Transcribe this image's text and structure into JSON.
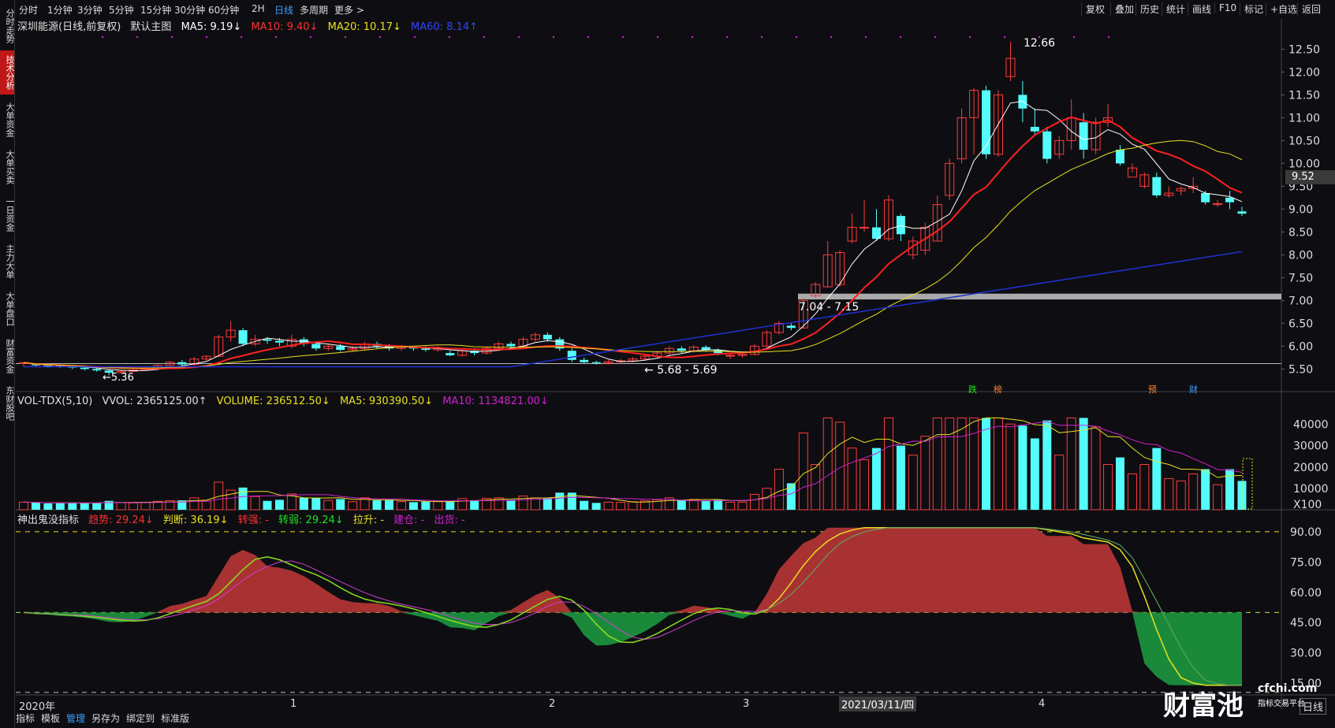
{
  "left_tabs": [
    "分时走势",
    "技术分析",
    "大单资金",
    "大单买卖",
    "一日资金",
    "主力大单",
    "大单盘口",
    "财富资金",
    "东财股吧"
  ],
  "left_tab_active": 1,
  "toolbar_left": [
    "分时",
    "1分钟",
    "3分钟",
    "5分钟",
    "15分钟",
    "30分钟",
    "60分钟",
    "2H",
    "日线",
    "多周期",
    "更多 >"
  ],
  "toolbar_active": "日线",
  "toolbar_right": [
    "复权",
    "叠加",
    "历史",
    "统计",
    "画线",
    "F10",
    "标记",
    "+自选",
    "返回"
  ],
  "main_legend": {
    "stock": "深圳能源(日线,前复权)",
    "chart_name": "默认主图",
    "ma5": "MA5: 9.19↓",
    "ma10": "MA10: 9.40↓",
    "ma20": "MA20: 10.17↓",
    "ma60": "MA60: 8.14↑"
  },
  "vol_legend": {
    "name": "VOL-TDX(5,10)",
    "vvol": "VVOL: 2365125.00↑",
    "volume": "VOLUME: 236512.50↓",
    "ma5": "MA5: 930390.50↓",
    "ma10": "MA10: 1134821.00↓"
  },
  "ind_legend": {
    "name": "神出鬼没指标",
    "trend": "趋势: 29.24↓",
    "judge": "判断: 36.19↓",
    "strong": "转强: -",
    "weak": "转弱: 29.24↓",
    "rise": "拉升: -",
    "build": "建仓: -",
    "ship": "出货: -"
  },
  "price_axis": [
    "12.50",
    "12.00",
    "11.50",
    "11.00",
    "10.50",
    "10.00",
    "9.50",
    "9.00",
    "8.50",
    "8.00",
    "7.50",
    "7.00",
    "6.50",
    "6.00",
    "5.50"
  ],
  "current_price": "9.52",
  "vol_axis": [
    "40000",
    "30000",
    "20000",
    "10000",
    "X100"
  ],
  "ind_axis": [
    "90.00",
    "75.00",
    "60.00",
    "45.00",
    "30.00",
    "15.00"
  ],
  "annotations": {
    "high": "12.66",
    "low1": "5.36",
    "low2": "5.68 - 5.69",
    "band": "7.04 - 7.15"
  },
  "markers": [
    "跌",
    "榜",
    "预",
    "财"
  ],
  "x_axis": [
    "2020年",
    "1",
    "2",
    "3",
    "2021/03/11/四",
    "4"
  ],
  "period_label": "日线",
  "bottom_bar": [
    "指标",
    "模板",
    "管理",
    "另存为",
    "绑定到",
    "标准版"
  ],
  "bottom_active": "管理",
  "watermark": {
    "big": "财富池",
    "site": "cfchi.com",
    "sub": "指标交易平台"
  },
  "colors": {
    "up": "#ff3b3b",
    "down": "#54fcfc",
    "ma5": "#ffffff",
    "ma10": "#ff2020",
    "ma20": "#e8e020",
    "ma60": "#2030d0",
    "area_up": "#a83232",
    "area_down": "#1a8a3a"
  },
  "chart_data": {
    "type": "candlestick",
    "price_range": [
      5.3,
      12.8
    ],
    "candles": [
      [
        5.62,
        5.64,
        5.55,
        5.66
      ],
      [
        5.6,
        5.58,
        5.54,
        5.63
      ],
      [
        5.58,
        5.57,
        5.53,
        5.6
      ],
      [
        5.57,
        5.55,
        5.52,
        5.59
      ],
      [
        5.55,
        5.53,
        5.5,
        5.57
      ],
      [
        5.53,
        5.5,
        5.47,
        5.55
      ],
      [
        5.5,
        5.47,
        5.44,
        5.52
      ],
      [
        5.47,
        5.42,
        5.36,
        5.49
      ],
      [
        5.42,
        5.45,
        5.4,
        5.48
      ],
      [
        5.45,
        5.48,
        5.43,
        5.5
      ],
      [
        5.48,
        5.52,
        5.46,
        5.54
      ],
      [
        5.52,
        5.58,
        5.5,
        5.6
      ],
      [
        5.58,
        5.65,
        5.56,
        5.68
      ],
      [
        5.65,
        5.6,
        5.55,
        5.7
      ],
      [
        5.6,
        5.72,
        5.58,
        5.76
      ],
      [
        5.72,
        5.78,
        5.68,
        5.8
      ],
      [
        5.78,
        6.2,
        5.76,
        6.25
      ],
      [
        6.2,
        6.35,
        6.1,
        6.55
      ],
      [
        6.35,
        6.05,
        6.0,
        6.4
      ],
      [
        6.05,
        6.15,
        6.0,
        6.25
      ],
      [
        6.15,
        6.12,
        6.05,
        6.2
      ],
      [
        6.12,
        6.08,
        6.0,
        6.18
      ],
      [
        6.0,
        6.15,
        5.95,
        6.25
      ],
      [
        6.15,
        6.05,
        6.0,
        6.2
      ],
      [
        6.05,
        5.95,
        5.9,
        6.1
      ],
      [
        5.95,
        6.0,
        5.9,
        6.05
      ],
      [
        6.0,
        5.92,
        5.88,
        6.05
      ],
      [
        5.92,
        5.95,
        5.88,
        6.0
      ],
      [
        5.95,
        6.05,
        5.9,
        6.1
      ],
      [
        6.05,
        6.0,
        5.95,
        6.1
      ],
      [
        6.0,
        5.95,
        5.9,
        6.05
      ],
      [
        5.95,
        5.98,
        5.9,
        6.02
      ],
      [
        5.98,
        5.95,
        5.9,
        6.0
      ],
      [
        5.95,
        5.92,
        5.88,
        6.0
      ],
      [
        5.92,
        5.95,
        5.88,
        6.0
      ],
      [
        5.85,
        5.8,
        5.78,
        5.9
      ],
      [
        5.8,
        5.9,
        5.78,
        5.95
      ],
      [
        5.9,
        5.85,
        5.8,
        5.95
      ],
      [
        5.85,
        5.95,
        5.82,
        6.0
      ],
      [
        5.95,
        6.05,
        5.9,
        6.1
      ],
      [
        6.05,
        6.0,
        5.95,
        6.1
      ],
      [
        6.0,
        6.15,
        5.98,
        6.2
      ],
      [
        6.15,
        6.25,
        6.1,
        6.3
      ],
      [
        6.25,
        6.15,
        6.1,
        6.3
      ],
      [
        6.15,
        5.95,
        5.9,
        6.2
      ],
      [
        5.9,
        5.7,
        5.65,
        5.95
      ],
      [
        5.7,
        5.65,
        5.62,
        5.75
      ],
      [
        5.65,
        5.63,
        5.6,
        5.68
      ],
      [
        5.63,
        5.66,
        5.6,
        5.7
      ],
      [
        5.66,
        5.68,
        5.62,
        5.72
      ],
      [
        5.68,
        5.72,
        5.65,
        5.76
      ],
      [
        5.72,
        5.78,
        5.7,
        5.82
      ],
      [
        5.78,
        5.85,
        5.75,
        5.9
      ],
      [
        5.85,
        5.95,
        5.8,
        6.0
      ],
      [
        5.95,
        5.9,
        5.85,
        6.0
      ],
      [
        5.9,
        5.98,
        5.86,
        6.02
      ],
      [
        5.98,
        5.92,
        5.88,
        6.02
      ],
      [
        5.92,
        5.85,
        5.8,
        5.95
      ],
      [
        5.8,
        5.8,
        5.72,
        5.85
      ],
      [
        5.8,
        5.82,
        5.75,
        5.86
      ],
      [
        5.82,
        6.0,
        5.8,
        6.05
      ],
      [
        6.0,
        6.3,
        5.98,
        6.35
      ],
      [
        6.3,
        6.5,
        6.25,
        6.55
      ],
      [
        6.45,
        6.4,
        6.35,
        6.5
      ],
      [
        6.4,
        7.0,
        6.38,
        7.05
      ],
      [
        7.1,
        7.35,
        7.05,
        7.4
      ],
      [
        7.3,
        8.0,
        7.28,
        8.3
      ],
      [
        7.35,
        8.05,
        7.3,
        8.1
      ],
      [
        8.3,
        8.6,
        8.25,
        8.9
      ],
      [
        8.6,
        8.6,
        8.5,
        9.2
      ],
      [
        8.6,
        8.35,
        8.3,
        9.0
      ],
      [
        8.35,
        9.2,
        8.3,
        9.3
      ],
      [
        8.85,
        8.45,
        8.3,
        8.9
      ],
      [
        8.0,
        8.3,
        7.9,
        8.4
      ],
      [
        8.1,
        8.6,
        8.0,
        8.7
      ],
      [
        8.3,
        9.1,
        8.3,
        9.3
      ],
      [
        9.3,
        10.0,
        9.2,
        10.1
      ],
      [
        10.1,
        11.0,
        10.0,
        11.2
      ],
      [
        11.0,
        11.6,
        10.2,
        11.65
      ],
      [
        11.6,
        10.2,
        10.1,
        11.7
      ],
      [
        10.2,
        11.5,
        10.15,
        11.6
      ],
      [
        11.9,
        12.3,
        11.8,
        12.66
      ],
      [
        11.5,
        11.2,
        10.9,
        11.8
      ],
      [
        10.8,
        10.7,
        10.6,
        11.2
      ],
      [
        10.7,
        10.1,
        10.0,
        10.8
      ],
      [
        10.2,
        10.5,
        10.1,
        10.6
      ],
      [
        10.5,
        11.0,
        10.3,
        11.4
      ],
      [
        10.9,
        10.3,
        10.1,
        11.1
      ],
      [
        10.3,
        10.9,
        10.2,
        11.0
      ],
      [
        10.9,
        11.0,
        10.8,
        11.3
      ],
      [
        10.3,
        10.0,
        9.95,
        10.4
      ],
      [
        9.7,
        9.9,
        9.8,
        10.0
      ],
      [
        9.5,
        9.75,
        9.45,
        9.8
      ],
      [
        9.7,
        9.3,
        9.25,
        9.8
      ],
      [
        9.3,
        9.35,
        9.25,
        9.5
      ],
      [
        9.4,
        9.45,
        9.3,
        9.5
      ],
      [
        9.45,
        9.5,
        9.35,
        9.7
      ],
      [
        9.35,
        9.15,
        9.1,
        9.4
      ],
      [
        9.1,
        9.12,
        9.05,
        9.2
      ],
      [
        9.25,
        9.15,
        9.0,
        9.4
      ],
      [
        8.95,
        8.9,
        8.85,
        9.05
      ]
    ]
  }
}
